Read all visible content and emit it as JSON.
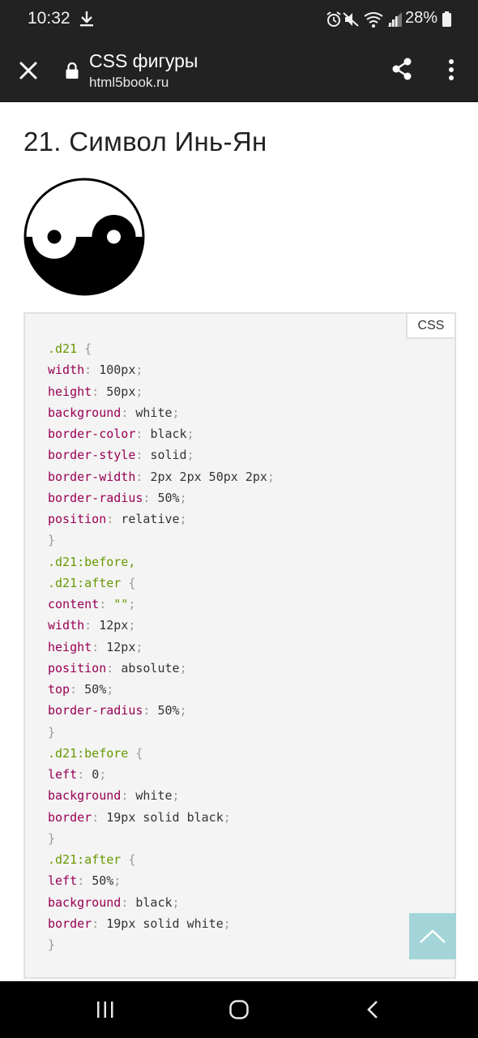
{
  "status_bar": {
    "time": "10:32",
    "battery": "28%",
    "icons": [
      "download-icon",
      "alarm-icon",
      "mute-icon",
      "wifi-icon",
      "signal-icon",
      "battery-icon"
    ]
  },
  "app_bar": {
    "title": "CSS фигуры",
    "url": "html5book.ru",
    "icons": [
      "close-icon",
      "lock-icon",
      "share-icon",
      "more-vert-icon"
    ]
  },
  "article": {
    "heading": "21. Символ Инь-Ян",
    "figure": "yin-yang-symbol"
  },
  "code_block": {
    "language_label": "CSS",
    "lines": [
      [
        {
          "t": "sel",
          "v": ".d21"
        },
        {
          "t": "punc",
          "v": " {"
        }
      ],
      [
        {
          "t": "prop",
          "v": "width"
        },
        {
          "t": "punc",
          "v": ": "
        },
        {
          "t": "val",
          "v": "100px"
        },
        {
          "t": "punc",
          "v": ";"
        }
      ],
      [
        {
          "t": "prop",
          "v": "height"
        },
        {
          "t": "punc",
          "v": ": "
        },
        {
          "t": "val",
          "v": "50px"
        },
        {
          "t": "punc",
          "v": ";"
        }
      ],
      [
        {
          "t": "prop",
          "v": "background"
        },
        {
          "t": "punc",
          "v": ": "
        },
        {
          "t": "val",
          "v": "white"
        },
        {
          "t": "punc",
          "v": ";"
        }
      ],
      [
        {
          "t": "prop",
          "v": "border-color"
        },
        {
          "t": "punc",
          "v": ": "
        },
        {
          "t": "val",
          "v": "black"
        },
        {
          "t": "punc",
          "v": ";"
        }
      ],
      [
        {
          "t": "prop",
          "v": "border-style"
        },
        {
          "t": "punc",
          "v": ": "
        },
        {
          "t": "val",
          "v": "solid"
        },
        {
          "t": "punc",
          "v": ";"
        }
      ],
      [
        {
          "t": "prop",
          "v": "border-width"
        },
        {
          "t": "punc",
          "v": ": "
        },
        {
          "t": "val",
          "v": "2px 2px 50px 2px"
        },
        {
          "t": "punc",
          "v": ";"
        }
      ],
      [
        {
          "t": "prop",
          "v": "border-radius"
        },
        {
          "t": "punc",
          "v": ": "
        },
        {
          "t": "val",
          "v": "50%"
        },
        {
          "t": "punc",
          "v": ";"
        }
      ],
      [
        {
          "t": "prop",
          "v": "position"
        },
        {
          "t": "punc",
          "v": ": "
        },
        {
          "t": "val",
          "v": "relative"
        },
        {
          "t": "punc",
          "v": ";"
        }
      ],
      [
        {
          "t": "punc",
          "v": "}"
        }
      ],
      [
        {
          "t": "sel",
          "v": ".d21:before,"
        }
      ],
      [
        {
          "t": "sel",
          "v": ".d21:after"
        },
        {
          "t": "punc",
          "v": " {"
        }
      ],
      [
        {
          "t": "prop",
          "v": "content"
        },
        {
          "t": "punc",
          "v": ": "
        },
        {
          "t": "sel",
          "v": "\"\""
        },
        {
          "t": "punc",
          "v": ";"
        }
      ],
      [
        {
          "t": "prop",
          "v": "width"
        },
        {
          "t": "punc",
          "v": ": "
        },
        {
          "t": "val",
          "v": "12px"
        },
        {
          "t": "punc",
          "v": ";"
        }
      ],
      [
        {
          "t": "prop",
          "v": "height"
        },
        {
          "t": "punc",
          "v": ": "
        },
        {
          "t": "val",
          "v": "12px"
        },
        {
          "t": "punc",
          "v": ";"
        }
      ],
      [
        {
          "t": "prop",
          "v": "position"
        },
        {
          "t": "punc",
          "v": ": "
        },
        {
          "t": "val",
          "v": "absolute"
        },
        {
          "t": "punc",
          "v": ";"
        }
      ],
      [
        {
          "t": "prop",
          "v": "top"
        },
        {
          "t": "punc",
          "v": ": "
        },
        {
          "t": "val",
          "v": "50%"
        },
        {
          "t": "punc",
          "v": ";"
        }
      ],
      [
        {
          "t": "prop",
          "v": "border-radius"
        },
        {
          "t": "punc",
          "v": ": "
        },
        {
          "t": "val",
          "v": "50%"
        },
        {
          "t": "punc",
          "v": ";"
        }
      ],
      [
        {
          "t": "punc",
          "v": "}"
        }
      ],
      [
        {
          "t": "sel",
          "v": ".d21:before"
        },
        {
          "t": "punc",
          "v": " {"
        }
      ],
      [
        {
          "t": "prop",
          "v": "left"
        },
        {
          "t": "punc",
          "v": ": "
        },
        {
          "t": "val",
          "v": "0"
        },
        {
          "t": "punc",
          "v": ";"
        }
      ],
      [
        {
          "t": "prop",
          "v": "background"
        },
        {
          "t": "punc",
          "v": ": "
        },
        {
          "t": "val",
          "v": "white"
        },
        {
          "t": "punc",
          "v": ";"
        }
      ],
      [
        {
          "t": "prop",
          "v": "border"
        },
        {
          "t": "punc",
          "v": ": "
        },
        {
          "t": "val",
          "v": "19px solid black"
        },
        {
          "t": "punc",
          "v": ";"
        }
      ],
      [
        {
          "t": "punc",
          "v": "}"
        }
      ],
      [
        {
          "t": "sel",
          "v": ".d21:after"
        },
        {
          "t": "punc",
          "v": " {"
        }
      ],
      [
        {
          "t": "prop",
          "v": "left"
        },
        {
          "t": "punc",
          "v": ": "
        },
        {
          "t": "val",
          "v": "50%"
        },
        {
          "t": "punc",
          "v": ";"
        }
      ],
      [
        {
          "t": "prop",
          "v": "background"
        },
        {
          "t": "punc",
          "v": ": "
        },
        {
          "t": "val",
          "v": "black"
        },
        {
          "t": "punc",
          "v": ";"
        }
      ],
      [
        {
          "t": "prop",
          "v": "border"
        },
        {
          "t": "punc",
          "v": ": "
        },
        {
          "t": "val",
          "v": "19px solid white"
        },
        {
          "t": "punc",
          "v": ";"
        }
      ],
      [
        {
          "t": "punc",
          "v": "}"
        }
      ]
    ]
  },
  "scroll_top_button": {
    "icon": "chevron-up-icon",
    "color": "#a3d5d8"
  },
  "nav_bar": {
    "icons": [
      "recents-icon",
      "home-icon",
      "back-icon"
    ]
  },
  "colors": {
    "status_bar_bg": "#222222",
    "selector": "#669900",
    "property": "#990055",
    "value": "#333333",
    "punctuation": "#999999"
  }
}
